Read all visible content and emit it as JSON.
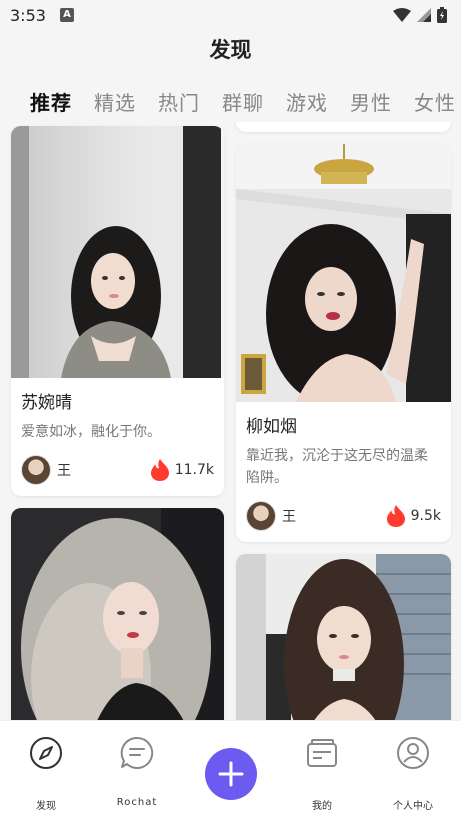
{
  "status": {
    "time": "3:53",
    "notification_badge": "A"
  },
  "header": {
    "title": "发现"
  },
  "tabs": [
    {
      "label": "推荐",
      "active": true
    },
    {
      "label": "精选",
      "active": false
    },
    {
      "label": "热门",
      "active": false
    },
    {
      "label": "群聊",
      "active": false
    },
    {
      "label": "游戏",
      "active": false
    },
    {
      "label": "男性",
      "active": false
    },
    {
      "label": "女性",
      "active": false
    }
  ],
  "cards": [
    {
      "name": "苏婉晴",
      "desc": "爱意如冰，融化于你。",
      "author": "王",
      "likes": "11.7k"
    },
    {
      "name": "柳如烟",
      "desc": "靠近我，沉沦于这无尽的温柔陷阱。",
      "author": "王",
      "likes": "9.5k"
    }
  ],
  "nav": {
    "discover": "发现",
    "rochat": "Rochat",
    "mine": "我的",
    "profile": "个人中心"
  },
  "colors": {
    "accent": "#6c5bf0",
    "fire": "#ff3b30"
  }
}
